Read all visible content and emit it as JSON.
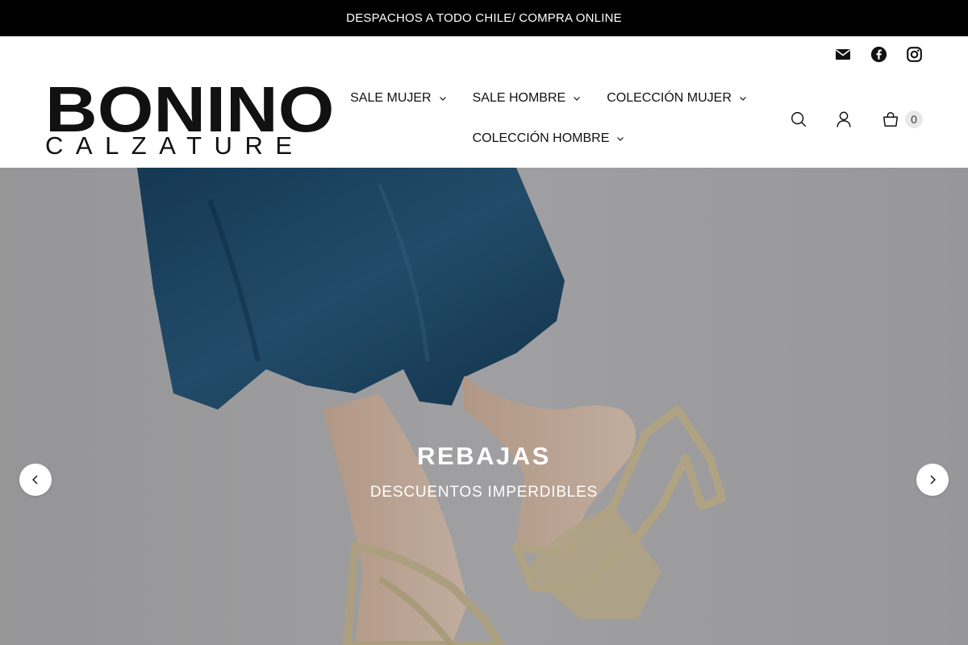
{
  "announcement": {
    "text": "DESPACHOS A TODO CHILE/ COMPRA ONLINE"
  },
  "social": [
    {
      "name": "email-icon"
    },
    {
      "name": "facebook-icon"
    },
    {
      "name": "instagram-icon"
    }
  ],
  "logo": {
    "top": "BONINO",
    "bottom": "CALZATURE"
  },
  "nav": {
    "items": [
      {
        "label": "SALE MUJER"
      },
      {
        "label": "SALE HOMBRE"
      },
      {
        "label": "COLECCIÓN MUJER"
      },
      {
        "label": "COLECCIÓN HOMBRE"
      }
    ]
  },
  "tools": {
    "search_icon": "search-icon",
    "account_icon": "account-icon",
    "cart_icon": "cart-icon",
    "cart_count": "0"
  },
  "hero": {
    "title": "REBAJAS",
    "subtitle": "DESCUENTOS IMPERDIBLES",
    "prev_icon": "chevron-left-icon",
    "next_icon": "chevron-right-icon"
  },
  "colors": {
    "announcement_bg": "#000000",
    "dress": "#1f4b6e",
    "sandal": "#d6c7a1",
    "background": "#b9b9bb"
  }
}
